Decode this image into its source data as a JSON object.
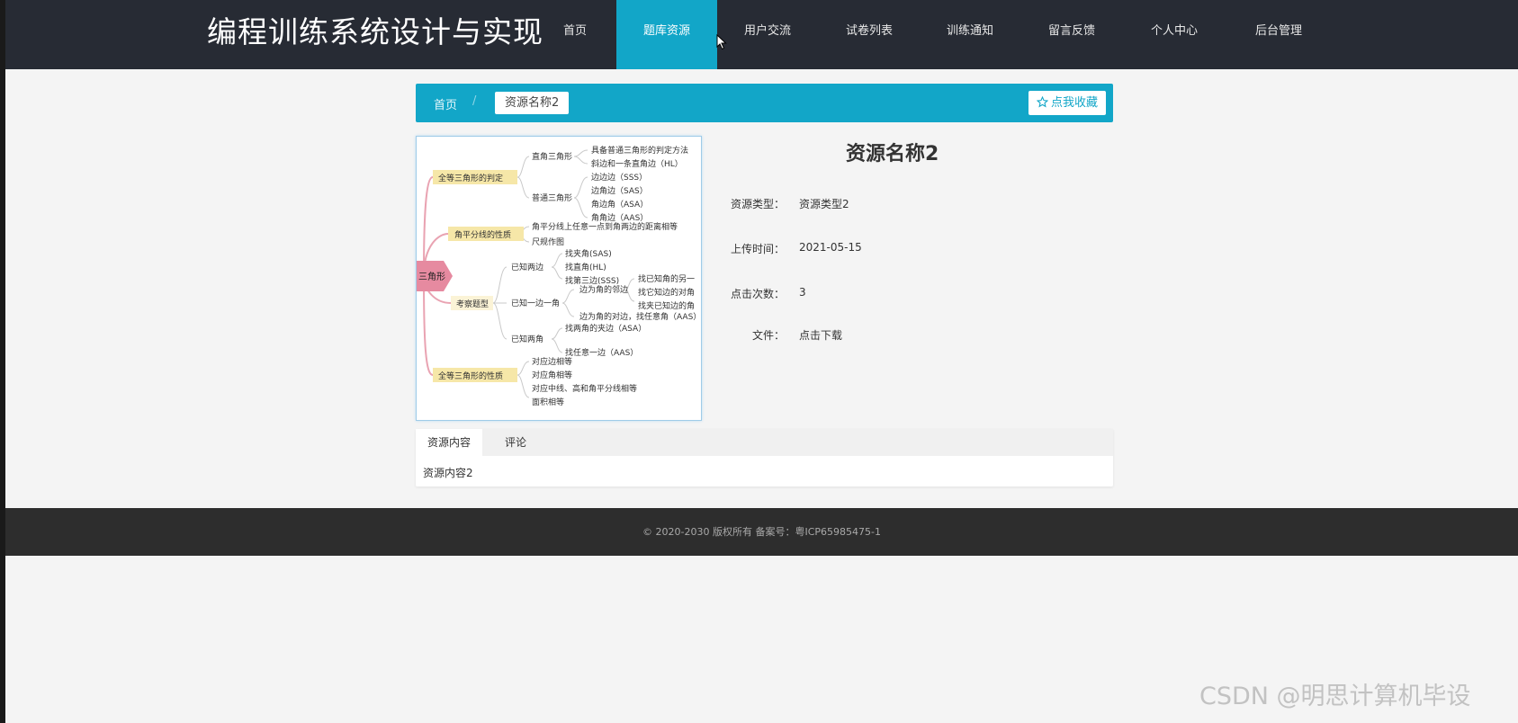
{
  "header": {
    "site_title": "编程训练系统设计与实现",
    "nav": [
      {
        "label": "首页",
        "active": false
      },
      {
        "label": "题库资源",
        "active": true
      },
      {
        "label": "用户交流",
        "active": false
      },
      {
        "label": "试卷列表",
        "active": false
      },
      {
        "label": "训练通知",
        "active": false
      },
      {
        "label": "留言反馈",
        "active": false
      },
      {
        "label": "个人中心",
        "active": false
      },
      {
        "label": "后台管理",
        "active": false
      }
    ]
  },
  "breadcrumb": {
    "home": "首页",
    "separator": "/",
    "current": "资源名称2"
  },
  "favorite_button": "点我收藏",
  "mindmap": {
    "center": "三角形",
    "branches": {
      "b1": "全等三角形的判定",
      "b2": "角平分线的性质",
      "b3": "考察题型",
      "b4": "全等三角形的性质"
    },
    "sub": {
      "s1": "直角三角形",
      "s2": "普通三角形",
      "s3": "已知两边",
      "s4": "已知一边一角",
      "s5": "已知两角",
      "s6": "边为角的邻边"
    },
    "leaves": {
      "l1": "具备普通三角形的判定方法",
      "l2": "斜边和一条直角边（HL）",
      "l3": "边边边（SSS）",
      "l4": "边角边（SAS）",
      "l5": "角边角（ASA）",
      "l6": "角角边（AAS）",
      "l7": "角平分线上任意一点到角两边的距离相等",
      "l8": "尺规作图",
      "l9": "找夹角(SAS)",
      "l10": "找直角(HL)",
      "l11": "找第三边(SSS)",
      "l12": "找已知角的另一",
      "l13": "找它知边的对角",
      "l14": "找夹已知边的角",
      "l15": "边为角的对边，找任意角（AAS）",
      "l16": "找两角的夹边（ASA）",
      "l17": "找任意一边（AAS）",
      "l18": "对应边相等",
      "l19": "对应角相等",
      "l20": "对应中线、高和角平分线相等",
      "l21": "面积相等"
    }
  },
  "detail": {
    "title": "资源名称2",
    "rows": [
      {
        "label": "资源类型：",
        "value": "资源类型2"
      },
      {
        "label": "上传时间：",
        "value": "2021-05-15"
      },
      {
        "label": "点击次数：",
        "value": "3"
      },
      {
        "label": "文件：",
        "value": "点击下载"
      }
    ]
  },
  "tabs": {
    "items": [
      "资源内容",
      "评论"
    ],
    "active": "资源内容",
    "body": "资源内容2"
  },
  "footer": {
    "text": "© 2020-2030 版权所有 备案号：粤ICP65985475-1"
  },
  "watermark": "CSDN @明思计算机毕设",
  "colors": {
    "accent": "#12a6c8",
    "header_bg": "#272b34",
    "footer_bg": "#2d2d2d"
  }
}
